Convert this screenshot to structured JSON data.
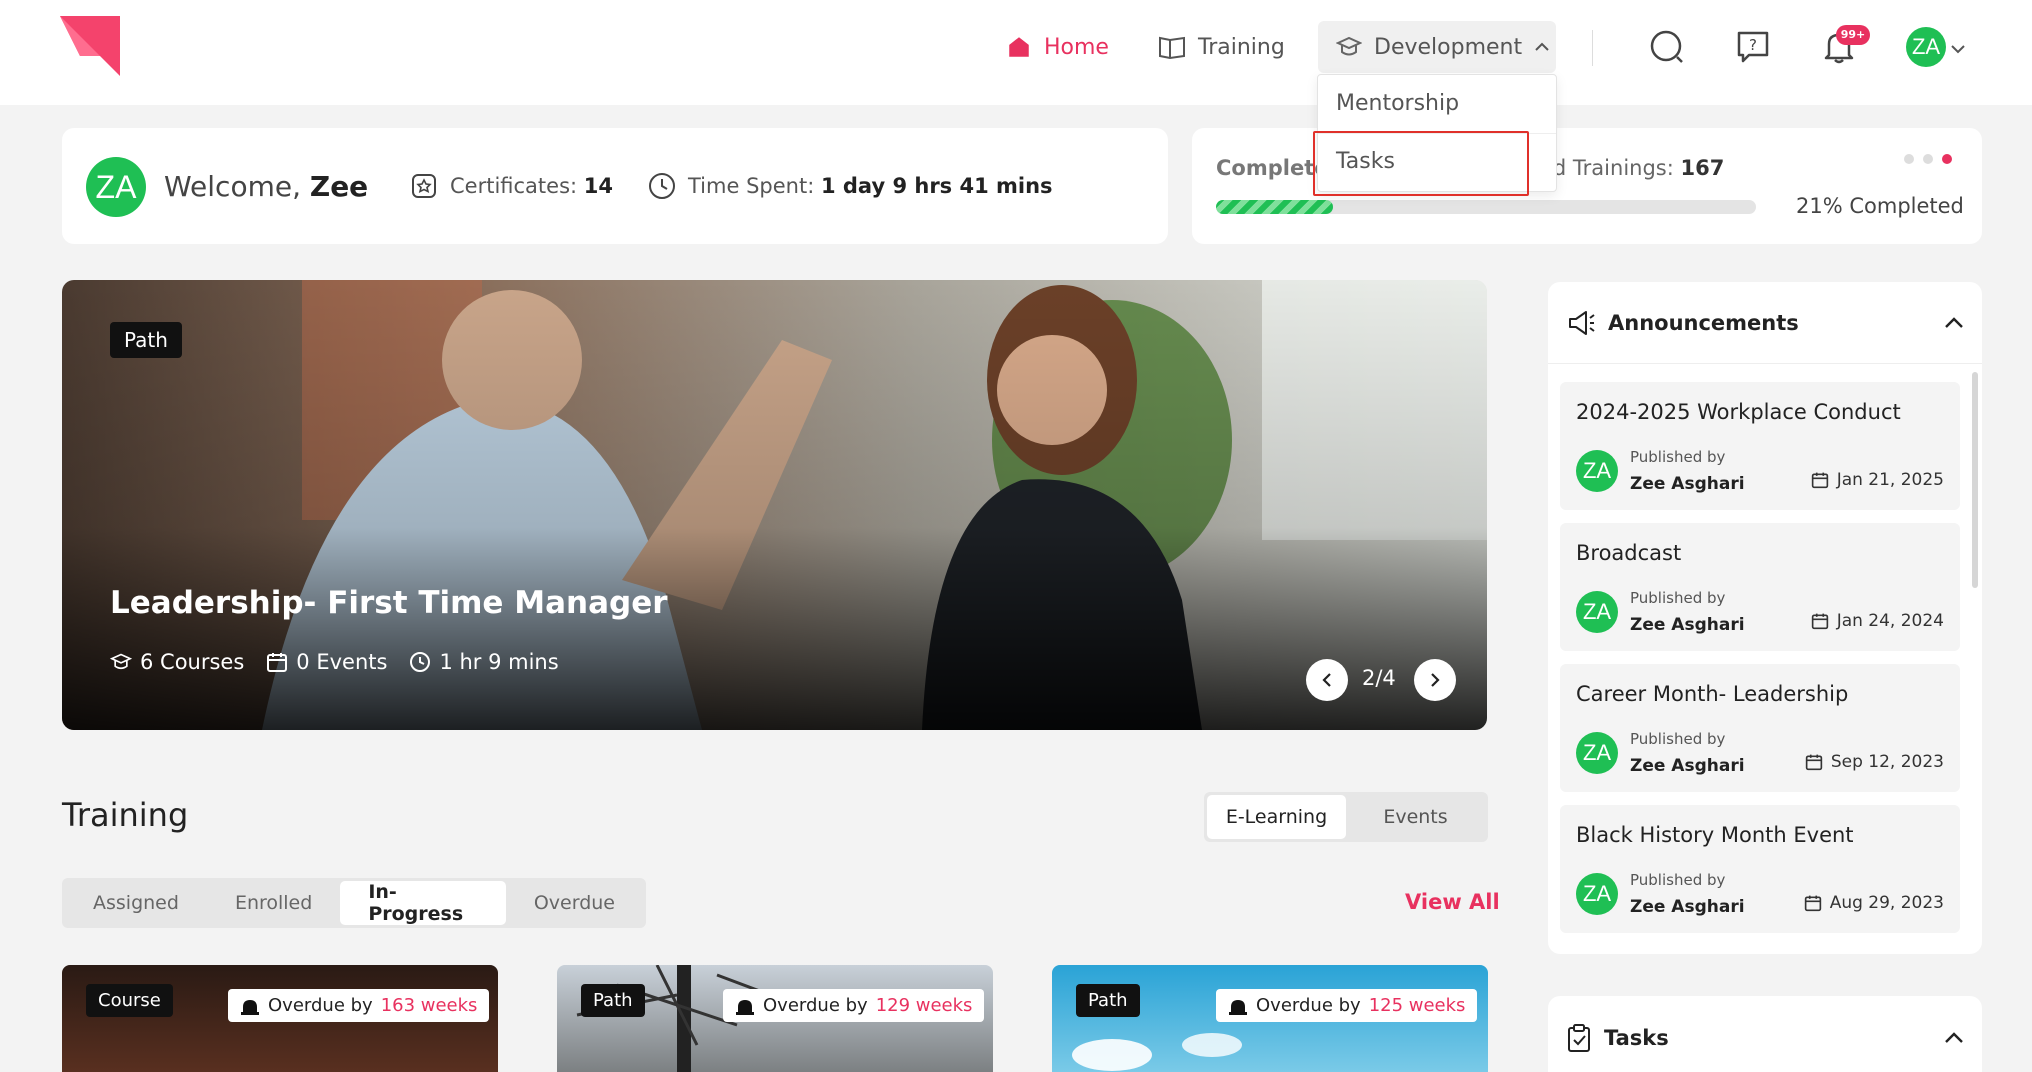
{
  "nav": {
    "home": "Home",
    "training": "Training",
    "development": "Development",
    "notifications_badge": "99+",
    "user_initials": "ZA"
  },
  "dropdown": {
    "items": [
      "Mentorship",
      "Tasks"
    ]
  },
  "welcome": {
    "initials": "ZA",
    "prefix": "Welcome,",
    "name": "Zee",
    "certificates_label": "Certificates:",
    "certificates_value": "14",
    "time_label": "Time Spent:",
    "time_value": "1 day 9 hrs 41 mins"
  },
  "stats": {
    "completed_label": "Complete",
    "assigned_label": "ed Trainings:",
    "assigned_value": "167",
    "progress_percent": 21,
    "progress_text": "21% Completed",
    "carousel_dots": 3,
    "active_dot": 3
  },
  "hero": {
    "tag": "Path",
    "title": "Leadership- First Time Manager",
    "courses": "6 Courses",
    "events": "0 Events",
    "duration": "1 hr 9 mins",
    "pager": "2/4"
  },
  "training": {
    "title": "Training",
    "mode_tabs": [
      "E-Learning",
      "Events"
    ],
    "active_mode": 0,
    "status_tabs": [
      "Assigned",
      "Enrolled",
      "In-Progress",
      "Overdue"
    ],
    "active_status": 2,
    "view_all": "View All",
    "cards": [
      {
        "type": "Course",
        "overdue_prefix": "Overdue by",
        "overdue_weeks": "163 weeks"
      },
      {
        "type": "Path",
        "overdue_prefix": "Overdue by",
        "overdue_weeks": "129 weeks"
      },
      {
        "type": "Path",
        "overdue_prefix": "Overdue by",
        "overdue_weeks": "125 weeks"
      }
    ]
  },
  "announcements": {
    "title": "Announcements",
    "items": [
      {
        "title": "2024-2025 Workplace Conduct",
        "published_by": "Published by",
        "author": "Zee Asghari",
        "initials": "ZA",
        "date": "Jan 21, 2025"
      },
      {
        "title": "Broadcast",
        "published_by": "Published by",
        "author": "Zee Asghari",
        "initials": "ZA",
        "date": "Jan 24, 2024"
      },
      {
        "title": "Career Month- Leadership",
        "published_by": "Published by",
        "author": "Zee Asghari",
        "initials": "ZA",
        "date": "Sep 12, 2023"
      },
      {
        "title": "Black History Month Event",
        "published_by": "Published by",
        "author": "Zee Asghari",
        "initials": "ZA",
        "date": "Aug 29, 2023"
      }
    ]
  },
  "tasks_panel": {
    "title": "Tasks"
  },
  "colors": {
    "accent": "#e8315f",
    "avatar_green": "#1fbf54",
    "highlight_box": "#e0302a"
  }
}
